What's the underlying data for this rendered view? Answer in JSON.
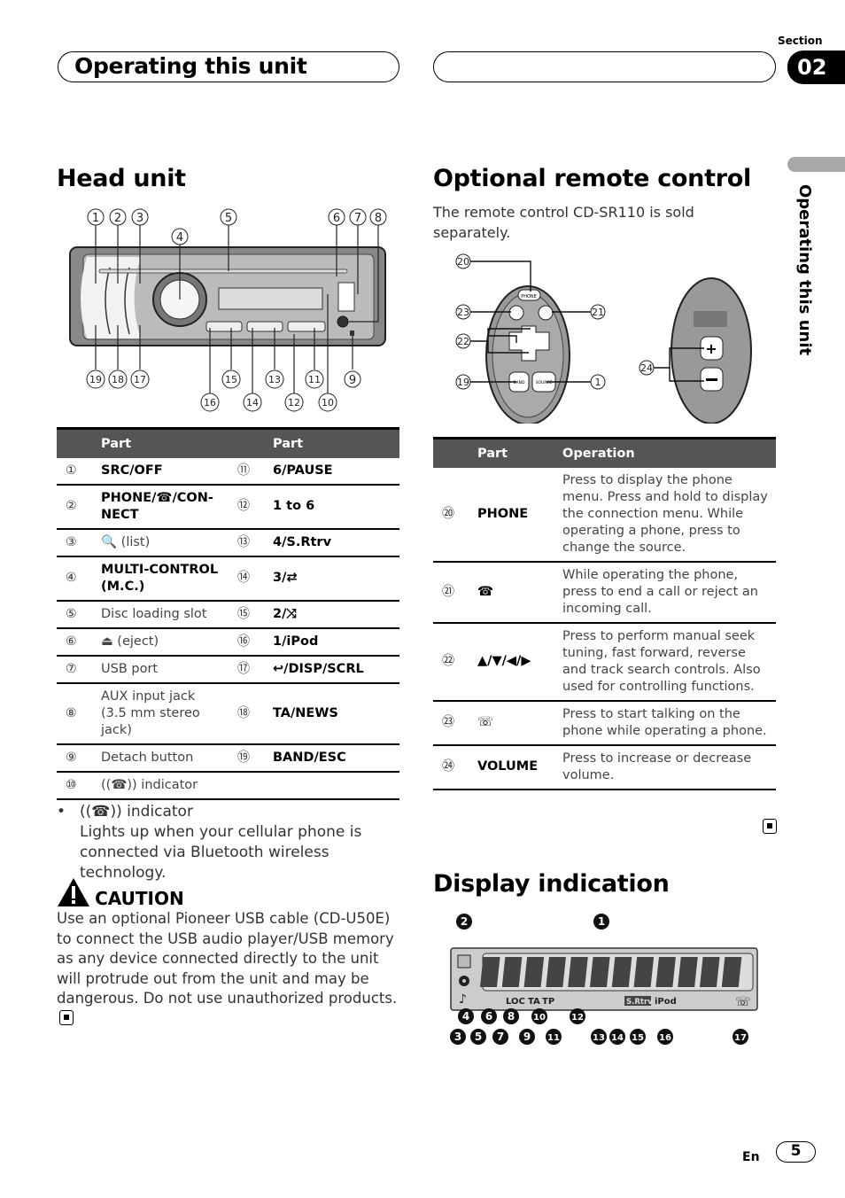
{
  "header": {
    "chapter_title": "Operating this unit",
    "section_label": "Section",
    "section_number": "02",
    "side_tab_label": "Operating this unit"
  },
  "head_unit": {
    "heading": "Head unit",
    "figure_callouts": [
      "1",
      "2",
      "3",
      "4",
      "5",
      "6",
      "7",
      "8",
      "9",
      "10",
      "11",
      "12",
      "13",
      "14",
      "15",
      "16",
      "17",
      "18",
      "19"
    ],
    "table": {
      "col1_header": "Part",
      "col2_header": "Part",
      "rows": [
        {
          "n1": "①",
          "p1": "SRC/OFF",
          "n2": "⑪",
          "p2": "6/PAUSE"
        },
        {
          "n1": "②",
          "p1": "PHONE/☎/CON-NECT",
          "n2": "⑫",
          "p2": "1 to 6"
        },
        {
          "n1": "③",
          "p1": "🔍 (list)",
          "n2": "⑬",
          "p2": "4/S.Rtrv"
        },
        {
          "n1": "④",
          "p1": "MULTI-CONTROL (M.C.)",
          "n2": "⑭",
          "p2": "3/⇄"
        },
        {
          "n1": "⑤",
          "p1": "Disc loading slot",
          "n2": "⑮",
          "p2": "2/⤨"
        },
        {
          "n1": "⑥",
          "p1": "⏏ (eject)",
          "n2": "⑯",
          "p2": "1/iPod"
        },
        {
          "n1": "⑦",
          "p1": "USB port",
          "n2": "⑰",
          "p2": "↩/DISP/SCRL"
        },
        {
          "n1": "⑧",
          "p1": "AUX input jack (3.5 mm stereo jack)",
          "n2": "⑱",
          "p2": "TA/NEWS"
        },
        {
          "n1": "⑨",
          "p1": "Detach button",
          "n2": "⑲",
          "p2": "BAND/ESC"
        },
        {
          "n1": "⑩",
          "p1": "((☎)) indicator",
          "n2": "",
          "p2": ""
        }
      ]
    },
    "bullet": {
      "title": "((☎)) indicator",
      "body": "Lights up when your cellular phone is connected via Bluetooth wireless technology."
    },
    "caution": {
      "title": "CAUTION",
      "body": "Use an optional Pioneer USB cable (CD-U50E) to connect the USB audio player/USB memory as any device connected directly to the unit will protrude out from the unit and may be dangerous. Do not use unauthorized products."
    }
  },
  "remote": {
    "heading": "Optional remote control",
    "intro": "The remote control CD-SR110 is sold separately.",
    "figure_callouts": [
      "20",
      "23",
      "22",
      "19",
      "21",
      "1",
      "24"
    ],
    "button_labels": {
      "phone": "PHONE",
      "band": "BAND",
      "source": "SOURCE"
    },
    "table": {
      "col1_header": "Part",
      "col2_header": "Operation",
      "rows": [
        {
          "n": "⑳",
          "part": "PHONE",
          "op": "Press to display the phone menu. Press and hold to display the connection menu. While operating a phone, press to change the source."
        },
        {
          "n": "㉑",
          "part": "☎",
          "op": "While operating the phone, press to end a call or reject an incoming call."
        },
        {
          "n": "㉒",
          "part": "▲/▼/◀/▶",
          "op": "Press to perform manual seek tuning, fast forward, reverse and track search controls. Also used for controlling functions."
        },
        {
          "n": "㉓",
          "part": "☏",
          "op": "Press to start talking on the phone while operating a phone."
        },
        {
          "n": "㉔",
          "part": "VOLUME",
          "op": "Press to increase or decrease volume."
        }
      ]
    }
  },
  "display": {
    "heading": "Display indication",
    "indicators": [
      "LOC",
      "TA",
      "TP",
      "S.Rtrv",
      "iPod"
    ],
    "callouts_top": [
      "2",
      "1"
    ],
    "callouts_row1": [
      "4",
      "6",
      "8",
      "10",
      "12"
    ],
    "callouts_row2": [
      "3",
      "5",
      "7",
      "9",
      "11",
      "13",
      "14",
      "15",
      "16",
      "17"
    ]
  },
  "footer": {
    "language": "En",
    "page_number": "5"
  }
}
